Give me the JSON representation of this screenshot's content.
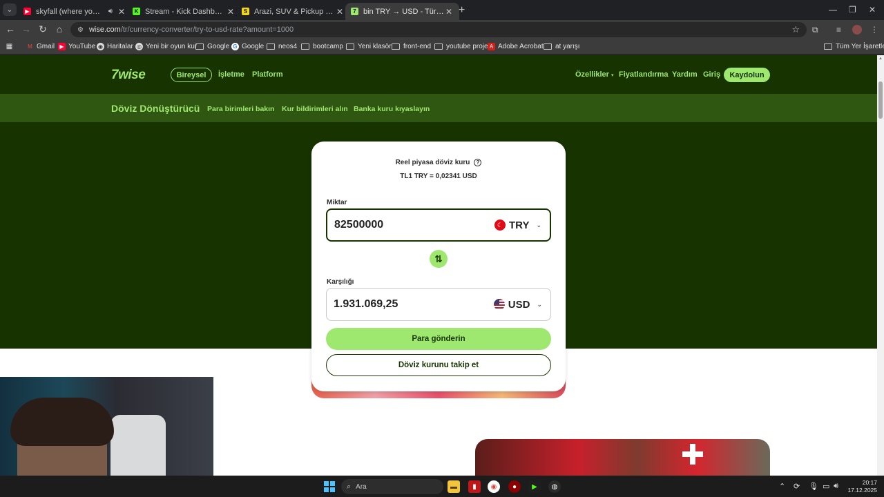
{
  "browser": {
    "tabs": [
      {
        "title": "skyfall (where you go i go x",
        "favicon_color": "#ff0033",
        "audio": true,
        "active": false
      },
      {
        "title": "Stream - Kick Dashboard",
        "favicon_color": "#53fc18",
        "active": false
      },
      {
        "title": "Arazi, SUV & Pickup Fiyatları &",
        "favicon_color": "#f5d90a",
        "active": false
      },
      {
        "title": "bin TRY → USD - Türk lirasından",
        "favicon_color": "#9fe870",
        "active": true
      }
    ],
    "url_host": "wise.com",
    "url_path": "/tr/currency-converter/try-to-usd-rate?amount=1000",
    "bookmarks": [
      "Gmail",
      "YouTube",
      "Haritalar",
      "Yeni bir oyun kur",
      "Google",
      "Google",
      "neos4",
      "bootcamp",
      "Yeni klasör",
      "front-end",
      "youtube proje",
      "Adobe Acrobat",
      "at yarışı"
    ],
    "all_bookmarks": "Tüm Yer İşaretleri"
  },
  "wise": {
    "logo": "7wise",
    "nav_left": {
      "personal": "Bireysel",
      "business": "İşletme",
      "platform": "Platform"
    },
    "nav_right": {
      "features": "Özellikler",
      "pricing": "Fiyatlandırma",
      "help": "Yardım",
      "login": "Giriş",
      "signup": "Kaydolun"
    },
    "subnav": {
      "title": "Döviz Dönüştürücü",
      "links": [
        "Para birimleri bakın",
        "Kur bildirimleri alın",
        "Banka kuru kıyaslayın"
      ]
    },
    "converter": {
      "rate_label": "Reel piyasa döviz kuru",
      "rate_value": "TL1 TRY = 0,02341 USD",
      "amount_label": "Miktar",
      "amount_value": "82500000",
      "from_currency": "TRY",
      "result_label": "Karşılığı",
      "result_value": "1.931.069,25",
      "to_currency": "USD",
      "send_button": "Para gönderin",
      "track_button": "Döviz kurunu takip et"
    },
    "colors": {
      "forest": "#163300",
      "lime": "#9fe870",
      "subnav": "#2f5711"
    }
  },
  "taskbar": {
    "search_placeholder": "Ara",
    "time": "20:17",
    "date": "17.12.2025"
  }
}
